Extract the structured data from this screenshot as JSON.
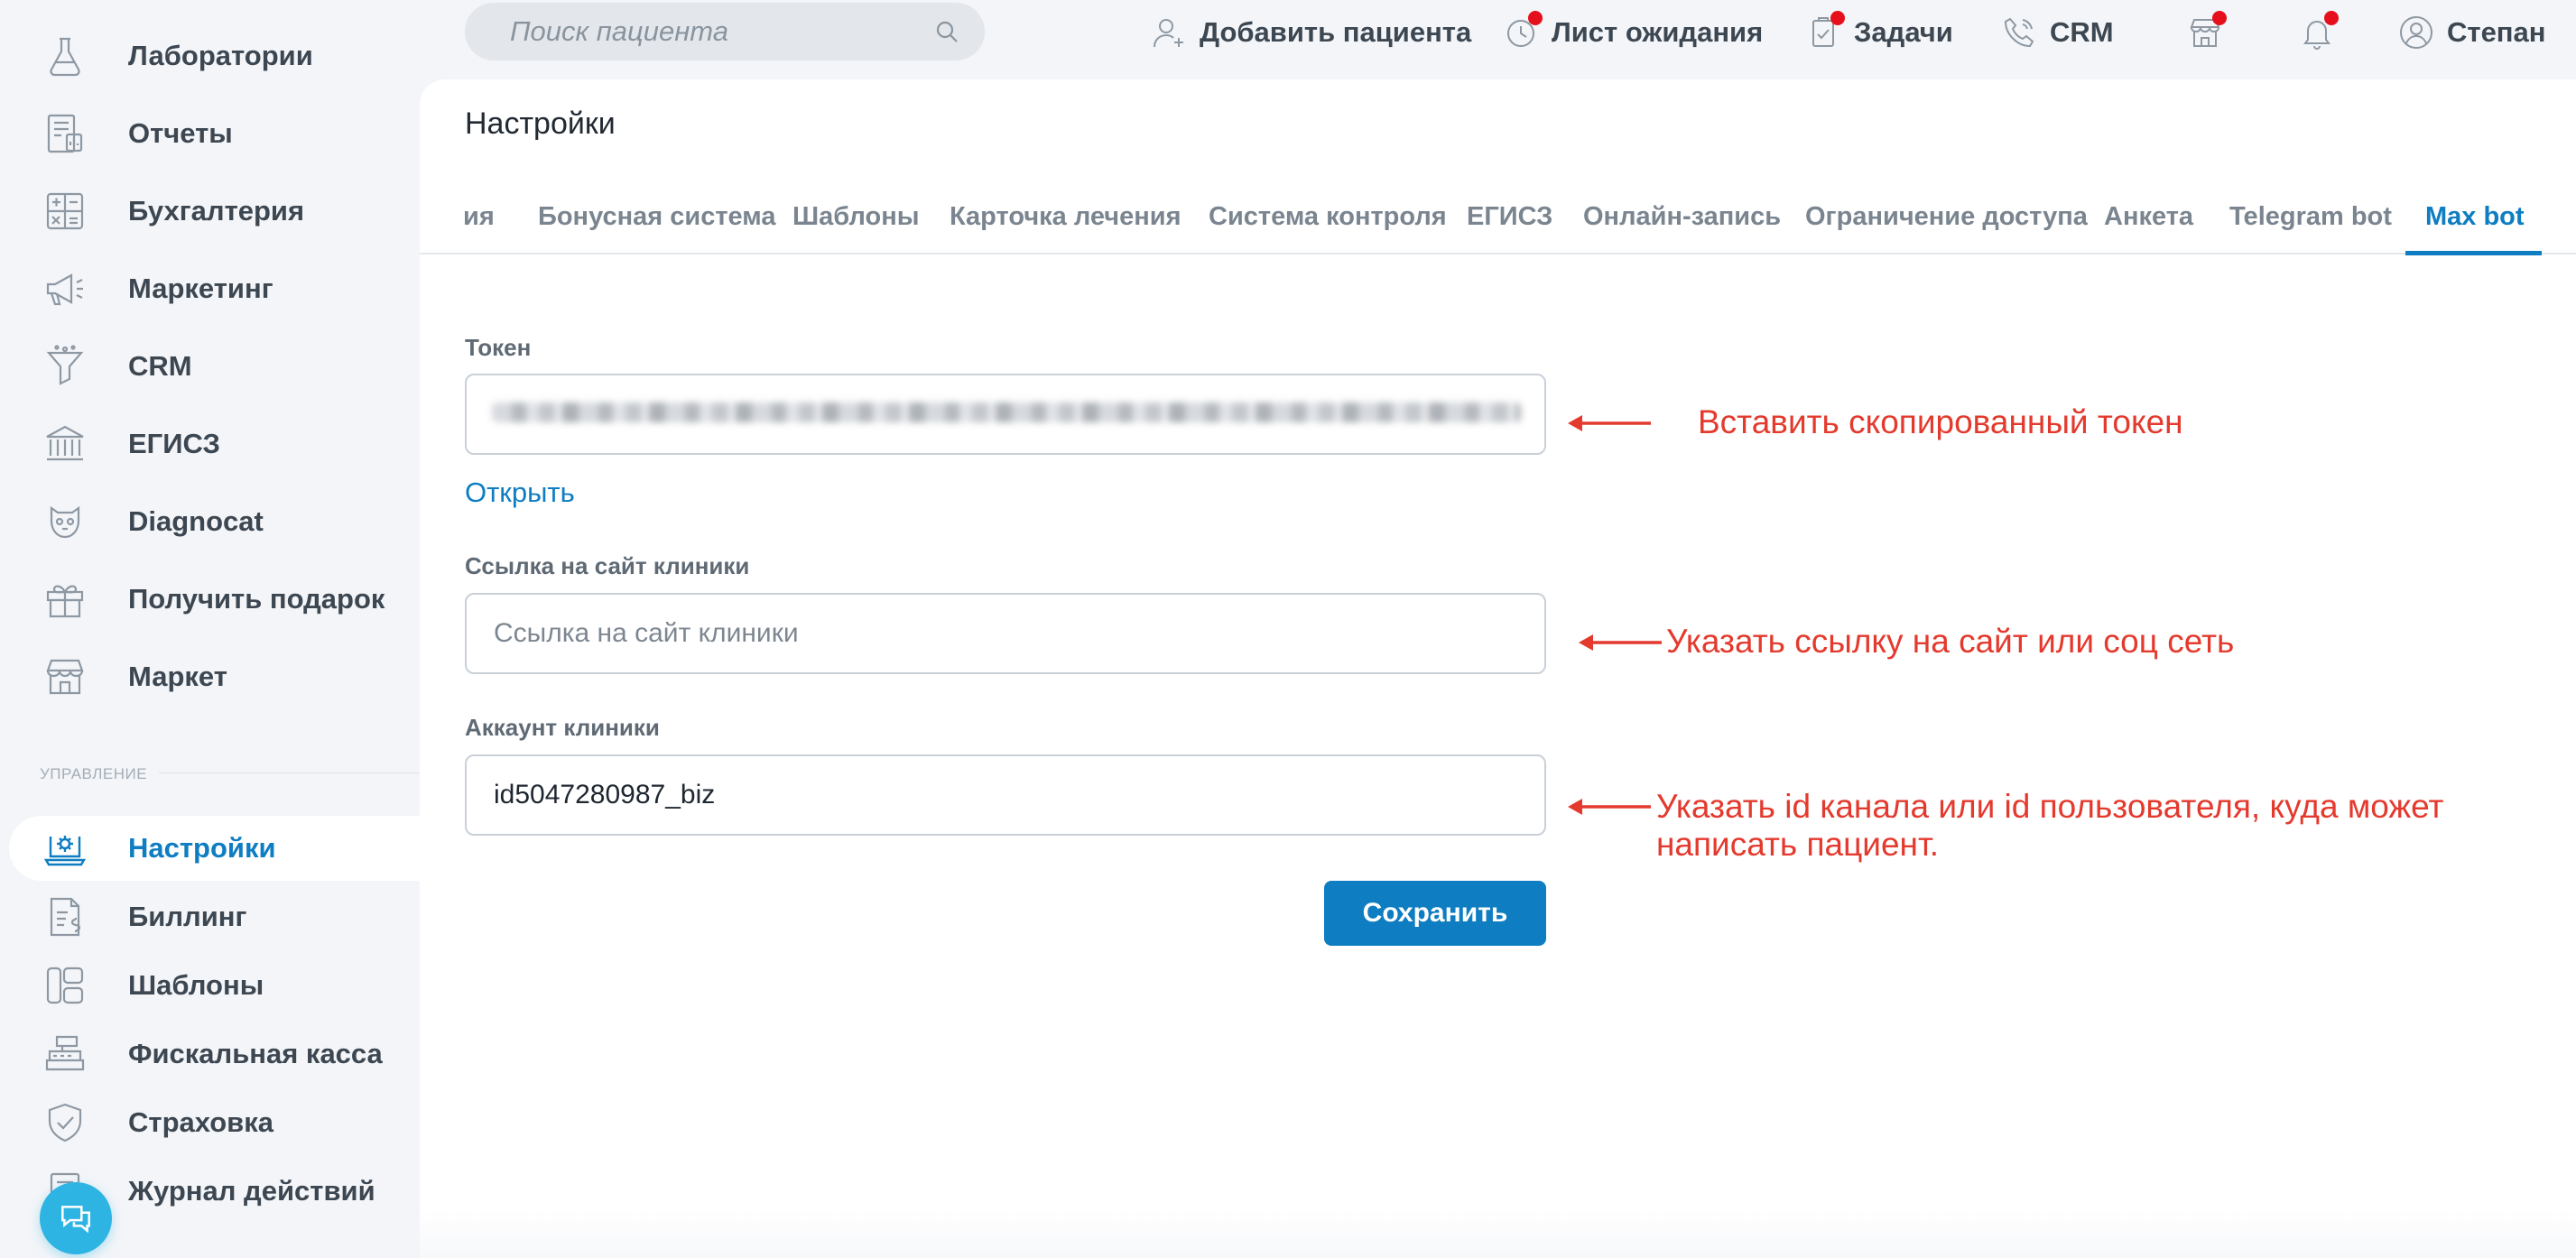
{
  "sidebar": {
    "items": [
      {
        "label": "Лаборатории",
        "icon": "flask-icon"
      },
      {
        "label": "Отчеты",
        "icon": "report-icon"
      },
      {
        "label": "Бухгалтерия",
        "icon": "calculator-icon"
      },
      {
        "label": "Маркетинг",
        "icon": "megaphone-icon"
      },
      {
        "label": "CRM",
        "icon": "funnel-icon"
      },
      {
        "label": "ЕГИСЗ",
        "icon": "bank-icon"
      },
      {
        "label": "Diagnocat",
        "icon": "diagnocat-icon"
      },
      {
        "label": "Получить подарок",
        "icon": "gift-icon"
      },
      {
        "label": "Маркет",
        "icon": "store-icon"
      }
    ],
    "section_label": "УПРАВЛЕНИЕ",
    "manage_items": [
      {
        "label": "Настройки",
        "icon": "settings-laptop-icon",
        "active": true
      },
      {
        "label": "Биллинг",
        "icon": "billing-icon"
      },
      {
        "label": "Шаблоны",
        "icon": "templates-icon"
      },
      {
        "label": "Фискальная касса",
        "icon": "cash-register-icon"
      },
      {
        "label": "Страховка",
        "icon": "shield-check-icon"
      },
      {
        "label": "Журнал действий",
        "icon": "journal-icon"
      }
    ]
  },
  "topbar": {
    "search_placeholder": "Поиск пациента",
    "add_patient": "Добавить пациента",
    "waiting_list": "Лист ожидания",
    "tasks": "Задачи",
    "crm": "CRM",
    "user": "Степан"
  },
  "main": {
    "title": "Настройки",
    "tabs": [
      {
        "label": "ия"
      },
      {
        "label": "Бонусная система"
      },
      {
        "label": "Шаблоны"
      },
      {
        "label": "Карточка лечения"
      },
      {
        "label": "Система контроля"
      },
      {
        "label": "ЕГИСЗ"
      },
      {
        "label": "Онлайн-запись"
      },
      {
        "label": "Ограничение доступа"
      },
      {
        "label": "Анкета"
      },
      {
        "label": "Telegram bot"
      },
      {
        "label": "Max bot",
        "active": true
      }
    ],
    "token_label": "Токен",
    "open_link": "Открыть",
    "site_label": "Ссылка на сайт клиники",
    "site_placeholder": "Ссылка на сайт клиники",
    "account_label": "Аккаунт клиники",
    "account_value": "id5047280987_biz",
    "save_label": "Сохранить"
  },
  "annotations": {
    "token_hint": "Вставить скопированный токен",
    "site_hint": "Указать ссылку на сайт или соц сеть",
    "account_hint_line1": "Указать id канала или id пользователя, куда может",
    "account_hint_line2": "написать пациент."
  },
  "colors": {
    "accent": "#0e7dc1",
    "annotation": "#e43a2e",
    "notification_dot": "#e5101c"
  }
}
